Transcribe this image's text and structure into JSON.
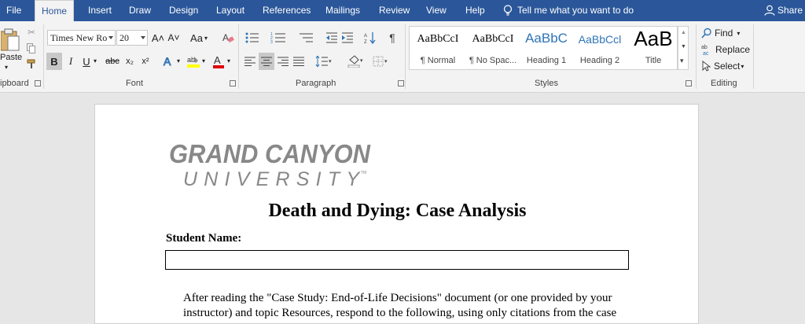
{
  "tabs": [
    {
      "label": "File"
    },
    {
      "label": "Home"
    },
    {
      "label": "Insert"
    },
    {
      "label": "Draw"
    },
    {
      "label": "Design"
    },
    {
      "label": "Layout"
    },
    {
      "label": "References"
    },
    {
      "label": "Mailings"
    },
    {
      "label": "Review"
    },
    {
      "label": "View"
    },
    {
      "label": "Help"
    }
  ],
  "tell_me": "Tell me what you want to do",
  "share": "Share",
  "clipboard": {
    "paste": "Paste",
    "label": "ipboard"
  },
  "font": {
    "name": "Times New Ro",
    "size": "20",
    "label": "Font",
    "bold": "B",
    "italic": "I",
    "underline": "U",
    "strike": "abc",
    "subscript": "x₂",
    "superscript": "x²",
    "grow": "A˄",
    "shrink": "A˅",
    "case": "Aa",
    "highlight_color": "#ffff00",
    "font_color": "#e00000"
  },
  "paragraph": {
    "label": "Paragraph"
  },
  "styles": {
    "label": "Styles",
    "items": [
      {
        "preview": "AaBbCcI",
        "name": "¶ Normal"
      },
      {
        "preview": "AaBbCcI",
        "name": "¶ No Spac..."
      },
      {
        "preview": "AaBbC",
        "name": "Heading 1"
      },
      {
        "preview": "AaBbCcl",
        "name": "Heading 2"
      },
      {
        "preview": "AaB",
        "name": "Title"
      }
    ]
  },
  "editing": {
    "label": "Editing",
    "find": "Find",
    "replace": "Replace",
    "select": "Select"
  },
  "document": {
    "logo_line1": "GRAND CANYON",
    "logo_line2": "UNIVERSITY",
    "logo_tm": "TM",
    "title": "Death and Dying: Case Analysis",
    "student_label": "Student Name:",
    "student_value": "",
    "paragraph": "After reading the \"Case Study: End-of-Life Decisions\" document (or one provided by your instructor) and topic Resources, respond to the following, using only citations from the case"
  },
  "colors": {
    "ribbon_blue": "#2b579a",
    "heading_blue": "#2e74b5"
  }
}
